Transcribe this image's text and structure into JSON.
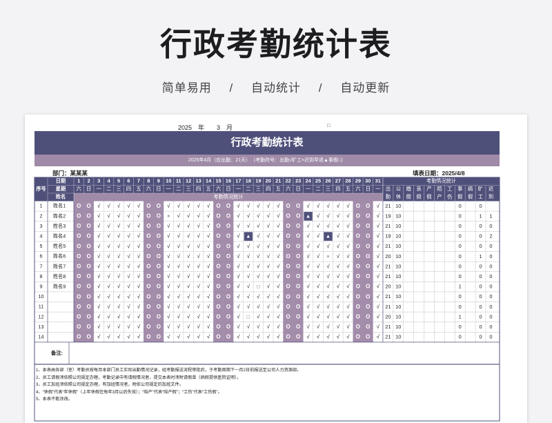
{
  "hero": {
    "title": "行政考勤统计表",
    "tags": [
      "简单易用",
      "自动统计",
      "自动更新"
    ],
    "separator": "/"
  },
  "sheet": {
    "year_month": "2025　年　　3　月",
    "ym_mark": "□",
    "title": "行政考勤统计表",
    "summary": "2025年4月（应出勤：21天）　（考勤符号：出勤√旷工×迟到早退▲事假□）",
    "department": "部门：某某某",
    "fill_date": "填表日期：2025/4/8",
    "headers": {
      "seq": "序号",
      "date": "日期",
      "weekday": "星期",
      "name": "姓名",
      "section": "考勤情况统计",
      "stats_title": "考勤情况统计",
      "stats": [
        "出勤",
        "公休",
        "婚假",
        "丧假",
        "产假",
        "陪产",
        "工伤",
        "事假",
        "病假",
        "旷工",
        "迟到"
      ]
    },
    "days": [
      "1",
      "2",
      "3",
      "4",
      "5",
      "6",
      "7",
      "8",
      "9",
      "10",
      "11",
      "12",
      "13",
      "14",
      "15",
      "16",
      "17",
      "18",
      "19",
      "20",
      "21",
      "22",
      "23",
      "24",
      "25",
      "26",
      "27",
      "28",
      "29",
      "30",
      "31"
    ],
    "weekdays": [
      "六",
      "日",
      "一",
      "二",
      "三",
      "四",
      "五",
      "六",
      "日",
      "一",
      "二",
      "三",
      "四",
      "五",
      "六",
      "日",
      "一",
      "二",
      "三",
      "四",
      "五",
      "六",
      "日",
      "一",
      "二",
      "三",
      "四",
      "五",
      "六",
      "日",
      "一"
    ],
    "weekend_days": [
      1,
      2,
      8,
      9,
      15,
      16,
      22,
      23,
      29,
      30
    ],
    "rows": [
      {
        "no": "1",
        "name": "姓名1",
        "marks": {},
        "stats": [
          "21",
          "10",
          "",
          "",
          "",
          "",
          "",
          "0",
          "",
          "0",
          ""
        ]
      },
      {
        "no": "2",
        "name": "姓名2",
        "marks": {
          "10": "×",
          "24": "▲"
        },
        "stats": [
          "19",
          "10",
          "",
          "",
          "",
          "",
          "",
          "0",
          "",
          "1",
          "1"
        ]
      },
      {
        "no": "3",
        "name": "姓名3",
        "marks": {},
        "stats": [
          "21",
          "10",
          "",
          "",
          "",
          "",
          "",
          "0",
          "",
          "0",
          "0"
        ]
      },
      {
        "no": "4",
        "name": "姓名4",
        "marks": {
          "18": "▲",
          "26": "▲"
        },
        "stats": [
          "19",
          "10",
          "",
          "",
          "",
          "",
          "",
          "0",
          "",
          "0",
          "2"
        ]
      },
      {
        "no": "5",
        "name": "姓名5",
        "marks": {},
        "stats": [
          "21",
          "10",
          "",
          "",
          "",
          "",
          "",
          "0",
          "",
          "0",
          "0"
        ]
      },
      {
        "no": "6",
        "name": "姓名6",
        "marks": {
          "26": "×"
        },
        "stats": [
          "20",
          "10",
          "",
          "",
          "",
          "",
          "",
          "0",
          "",
          "1",
          "0"
        ]
      },
      {
        "no": "7",
        "name": "姓名7",
        "marks": {},
        "stats": [
          "21",
          "10",
          "",
          "",
          "",
          "",
          "",
          "0",
          "",
          "0",
          "0"
        ]
      },
      {
        "no": "8",
        "name": "姓名8",
        "marks": {},
        "stats": [
          "21",
          "10",
          "",
          "",
          "",
          "",
          "",
          "0",
          "",
          "0",
          "0"
        ]
      },
      {
        "no": "9",
        "name": "姓名9",
        "marks": {
          "19": "□"
        },
        "stats": [
          "20",
          "10",
          "",
          "",
          "",
          "",
          "",
          "1",
          "",
          "0",
          "0"
        ]
      },
      {
        "no": "10",
        "name": "",
        "marks": {},
        "stats": [
          "21",
          "10",
          "",
          "",
          "",
          "",
          "",
          "0",
          "",
          "0",
          "0"
        ]
      },
      {
        "no": "11",
        "name": "",
        "marks": {},
        "stats": [
          "21",
          "10",
          "",
          "",
          "",
          "",
          "",
          "0",
          "",
          "0",
          "0"
        ]
      },
      {
        "no": "12",
        "name": "",
        "marks": {
          "18": "□"
        },
        "stats": [
          "20",
          "10",
          "",
          "",
          "",
          "",
          "",
          "1",
          "",
          "0",
          "0"
        ]
      },
      {
        "no": "13",
        "name": "",
        "marks": {},
        "stats": [
          "21",
          "10",
          "",
          "",
          "",
          "",
          "",
          "0",
          "",
          "0",
          "0"
        ]
      },
      {
        "no": "14",
        "name": "",
        "marks": {},
        "stats": [
          "21",
          "10",
          "",
          "",
          "",
          "",
          "",
          "0",
          "",
          "0",
          "0"
        ]
      }
    ],
    "symbols": {
      "present": "√",
      "rest": "O"
    },
    "remarks_label": "备注:",
    "notes": [
      "1、本表由各部（室）考勤员按每月本部门员工实际出勤情况记录，经考勤报送流程审批后，于考勤周期下一月2日前报送至公司人力资源部。",
      "2、员工请假须依照公司规定办理，考勤记录中有请假情况者，提交本表时须附请假单（病假提供医院证明）。",
      "3、员工加班须依照公司规定办理，有加班情况者，附依公司规定的加班文件。",
      "4、“休假”代表“年休假”（上年休假在每年3月以后失效）；“陪产”代表“陪产假”；“工伤”代表“工伤假”。",
      "5、本表不能涂改。"
    ],
    "colors": {
      "header": "#4f507a",
      "accent": "#9f8aa7",
      "weekend": "#a48cab"
    }
  }
}
